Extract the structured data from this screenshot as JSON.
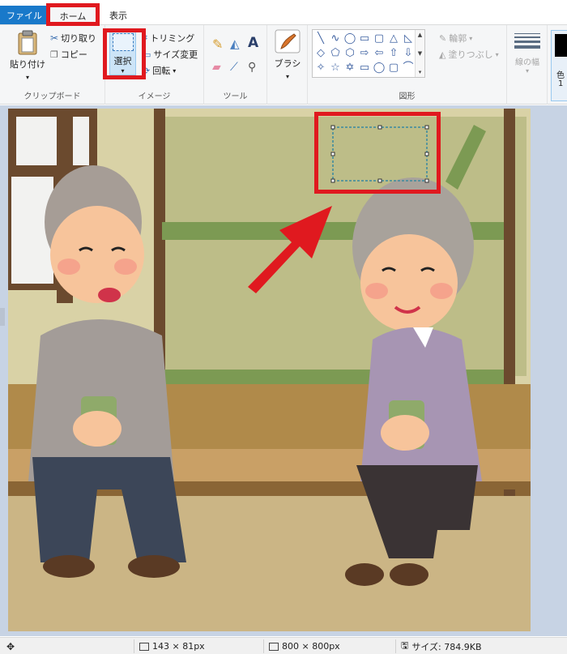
{
  "tabs": {
    "file": "ファイル",
    "home": "ホーム",
    "view": "表示"
  },
  "clipboard": {
    "paste": "貼り付け",
    "cut": "切り取り",
    "copy": "コピー",
    "group_label": "クリップボード"
  },
  "image": {
    "select": "選択",
    "crop": "トリミング",
    "resize": "サイズ変更",
    "rotate": "回転",
    "group_label": "イメージ"
  },
  "tools": {
    "group_label": "ツール",
    "items": [
      "pencil-icon",
      "fill-icon",
      "text-icon",
      "eraser-icon",
      "color-picker-icon",
      "magnifier-icon"
    ]
  },
  "brush": {
    "label": "ブラシ"
  },
  "shapes": {
    "group_label": "図形",
    "outline": "輪郭",
    "fill": "塗りつぶし",
    "glyphs": [
      "╲",
      "∿",
      "◯",
      "▭",
      "▢",
      "△",
      "◺",
      "◇",
      "⬠",
      "⬡",
      "⇨",
      "⇦",
      "⇧",
      "⇩",
      "✧",
      "☆",
      "✡",
      "▭",
      "◯",
      "▢",
      "⌒"
    ]
  },
  "line_width": {
    "label": "線の幅"
  },
  "color": {
    "label_partial": "色",
    "number_partial": "1",
    "swatch": "#000000"
  },
  "status": {
    "selection_size": "143 × 81px",
    "image_size": "800 × 800px",
    "file_size": "サイズ: 784.9KB"
  },
  "colors": {
    "accent": "#1979ca",
    "highlight": "#e0191f",
    "canvas_bg": "#c7d3e4"
  }
}
